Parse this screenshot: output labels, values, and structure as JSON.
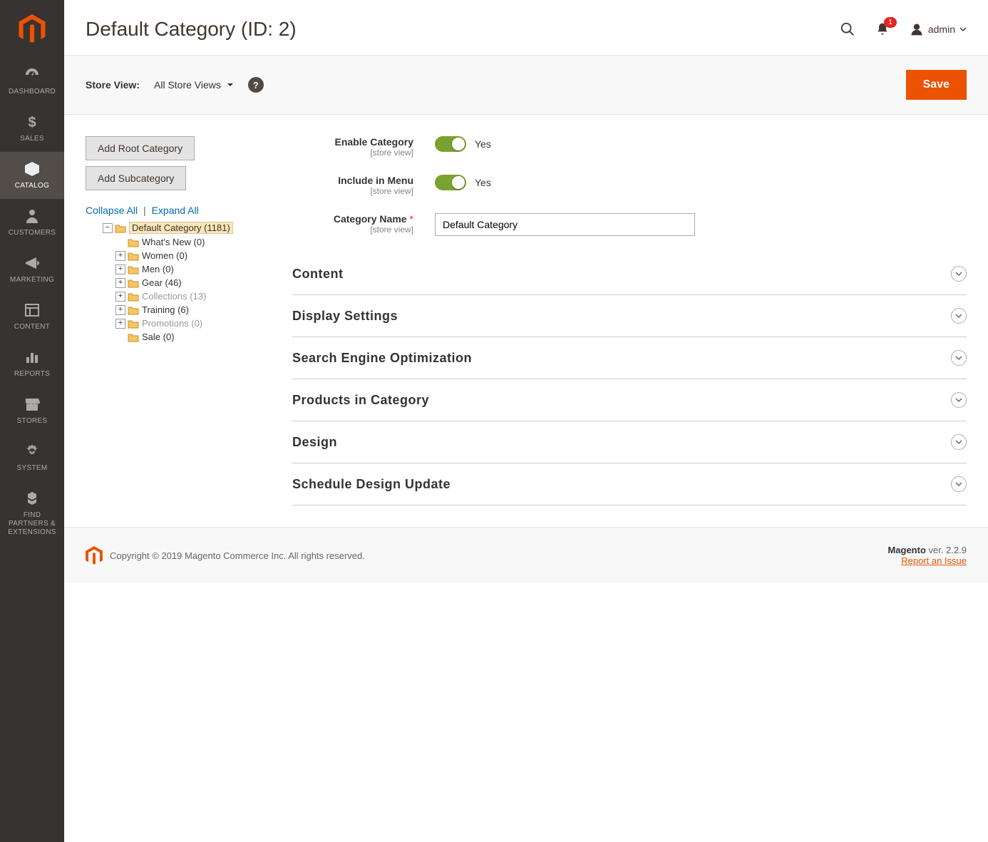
{
  "sidebar": {
    "items": [
      {
        "label": "DASHBOARD"
      },
      {
        "label": "SALES"
      },
      {
        "label": "CATALOG"
      },
      {
        "label": "CUSTOMERS"
      },
      {
        "label": "MARKETING"
      },
      {
        "label": "CONTENT"
      },
      {
        "label": "REPORTS"
      },
      {
        "label": "STORES"
      },
      {
        "label": "SYSTEM"
      },
      {
        "label": "FIND PARTNERS & EXTENSIONS"
      }
    ],
    "active_index": 2
  },
  "header": {
    "title": "Default Category (ID: 2)",
    "notification_count": "1",
    "user": "admin"
  },
  "toolbar": {
    "store_view_label": "Store View:",
    "store_view_value": "All Store Views",
    "save_label": "Save"
  },
  "left_pane": {
    "add_root_label": "Add Root Category",
    "add_sub_label": "Add Subcategory",
    "collapse_all": "Collapse All",
    "expand_all": "Expand All"
  },
  "tree": {
    "root": {
      "label": "Default Category (1181)",
      "selected": true
    },
    "children": [
      {
        "label": "What's New (0)",
        "leaf": true
      },
      {
        "label": "Women (0)"
      },
      {
        "label": "Men (0)"
      },
      {
        "label": "Gear (46)"
      },
      {
        "label": "Collections (13)",
        "disabled": true
      },
      {
        "label": "Training (6)"
      },
      {
        "label": "Promotions (0)",
        "disabled": true
      },
      {
        "label": "Sale (0)",
        "leaf": true
      }
    ]
  },
  "form": {
    "enable_category": {
      "label": "Enable Category",
      "scope": "[store view]",
      "value": "Yes"
    },
    "include_in_menu": {
      "label": "Include in Menu",
      "scope": "[store view]",
      "value": "Yes"
    },
    "category_name": {
      "label": "Category Name",
      "scope": "[store view]",
      "value": "Default Category"
    }
  },
  "accordions": [
    {
      "title": "Content"
    },
    {
      "title": "Display Settings"
    },
    {
      "title": "Search Engine Optimization"
    },
    {
      "title": "Products in Category"
    },
    {
      "title": "Design"
    },
    {
      "title": "Schedule Design Update"
    }
  ],
  "footer": {
    "copyright": "Copyright © 2019 Magento Commerce Inc. All rights reserved.",
    "product": "Magento",
    "version": " ver. 2.2.9",
    "report_link": "Report an Issue"
  }
}
